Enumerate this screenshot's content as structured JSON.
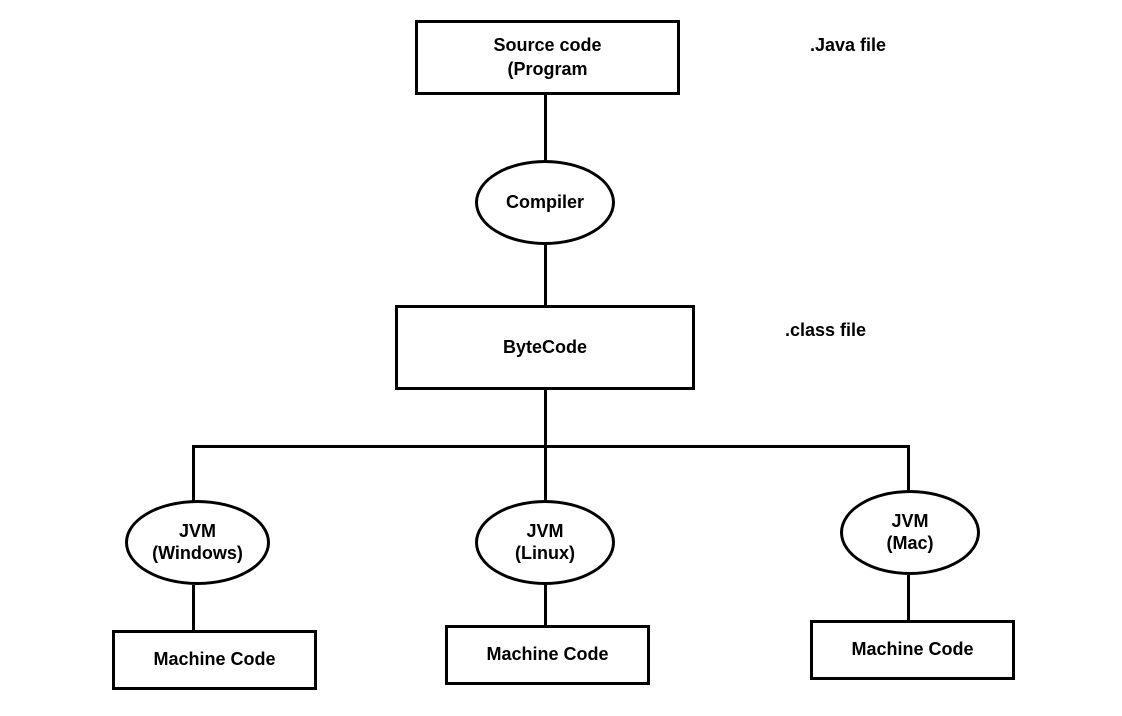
{
  "nodes": {
    "source_code": {
      "line1": "Source code",
      "line2": "(Program"
    },
    "compiler": "Compiler",
    "bytecode": "ByteCode",
    "jvm_windows": {
      "line1": "JVM",
      "line2": "(Windows)"
    },
    "jvm_linux": {
      "line1": "JVM",
      "line2": "(Linux)"
    },
    "jvm_mac": {
      "line1": "JVM",
      "line2": "(Mac)"
    },
    "machine_code_1": "Machine Code",
    "machine_code_2": "Machine Code",
    "machine_code_3": "Machine Code"
  },
  "annotations": {
    "java_file": ".Java file",
    "class_file": ".class file"
  }
}
